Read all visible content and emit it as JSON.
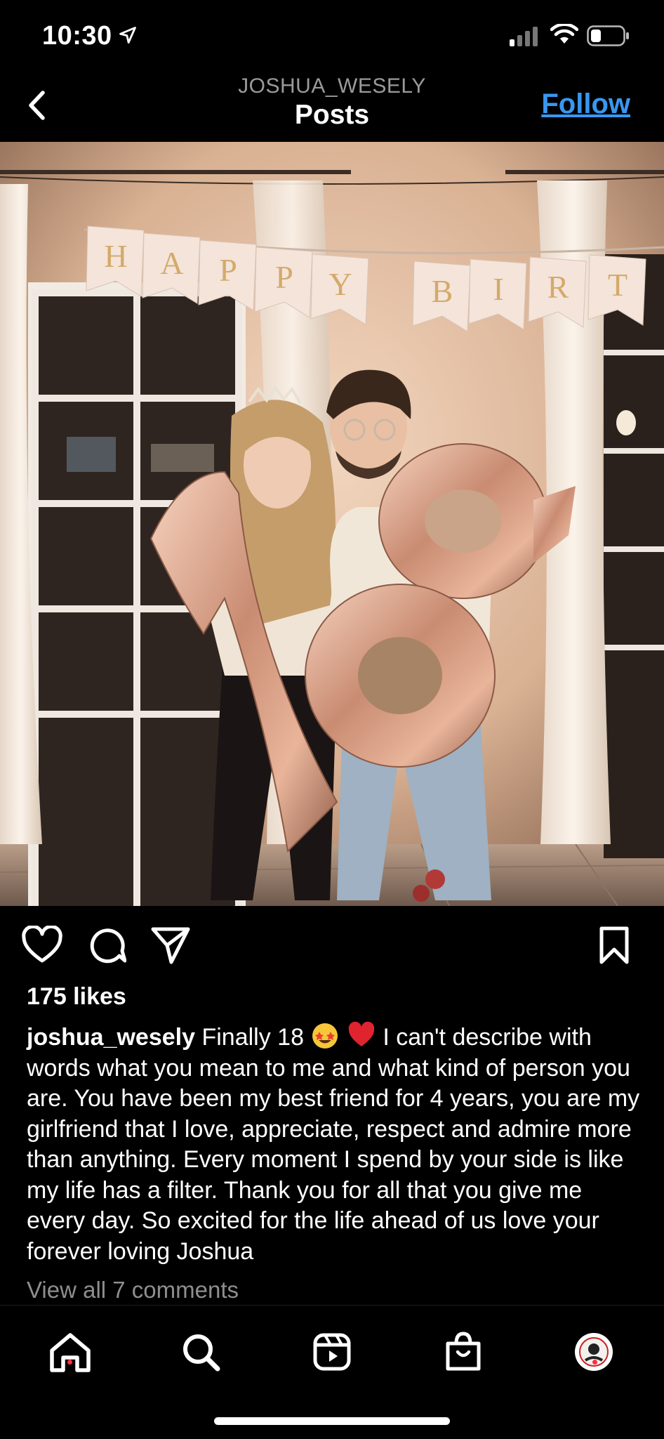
{
  "status_bar": {
    "time": "10:30"
  },
  "header": {
    "username": "JOSHUA_WESELY",
    "title": "Posts",
    "follow_label": "Follow"
  },
  "post": {
    "banner_letters": [
      "H",
      "A",
      "P",
      "P",
      "Y",
      "B",
      "I",
      "R",
      "T"
    ],
    "balloon_number": "18",
    "likes": "175 likes",
    "caption_username": "joshua_wesely",
    "caption_start": "Finally 18",
    "caption_rest": "I can't describe with words what you mean to me and what kind of person you are. You have been my best friend for 4 years, you are my girlfriend that I love, appreciate, respect and admire more than anything. Every moment I spend by your side is like my life has a filter. Thank you for all that you give me every day. So excited for the life ahead of us love your forever loving Joshua",
    "view_comments": "View all 7 comments"
  },
  "icons": {
    "actions": [
      "heart-icon",
      "comment-icon",
      "share-icon",
      "bookmark-icon"
    ],
    "tabs": [
      "home-icon",
      "search-icon",
      "reels-icon",
      "shop-icon",
      "profile-avatar"
    ]
  },
  "colors": {
    "background": "#000000",
    "link": "#3897f0",
    "muted": "#8e8e8e",
    "notification_dot": "#ff3040"
  }
}
